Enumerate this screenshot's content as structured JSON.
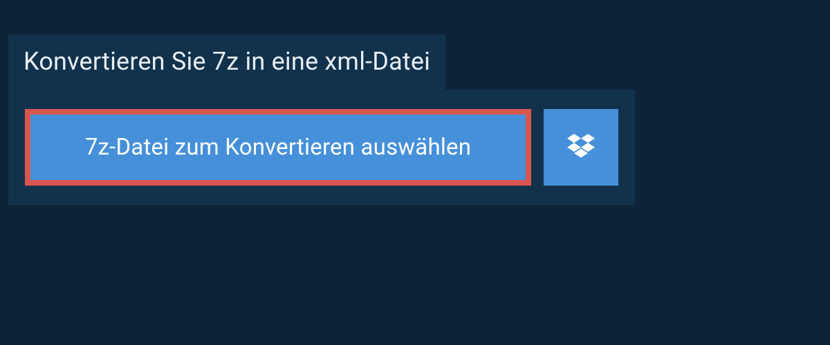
{
  "header": {
    "title": "Konvertieren Sie 7z in eine xml-Datei"
  },
  "actions": {
    "select_file_label": "7z-Datei zum Konvertieren auswählen",
    "dropbox_icon_name": "dropbox-icon"
  },
  "colors": {
    "background": "#0d2438",
    "panel": "#12324c",
    "button": "#4690d9",
    "highlight_border": "#d9564f",
    "text_light": "#e8eef3"
  }
}
